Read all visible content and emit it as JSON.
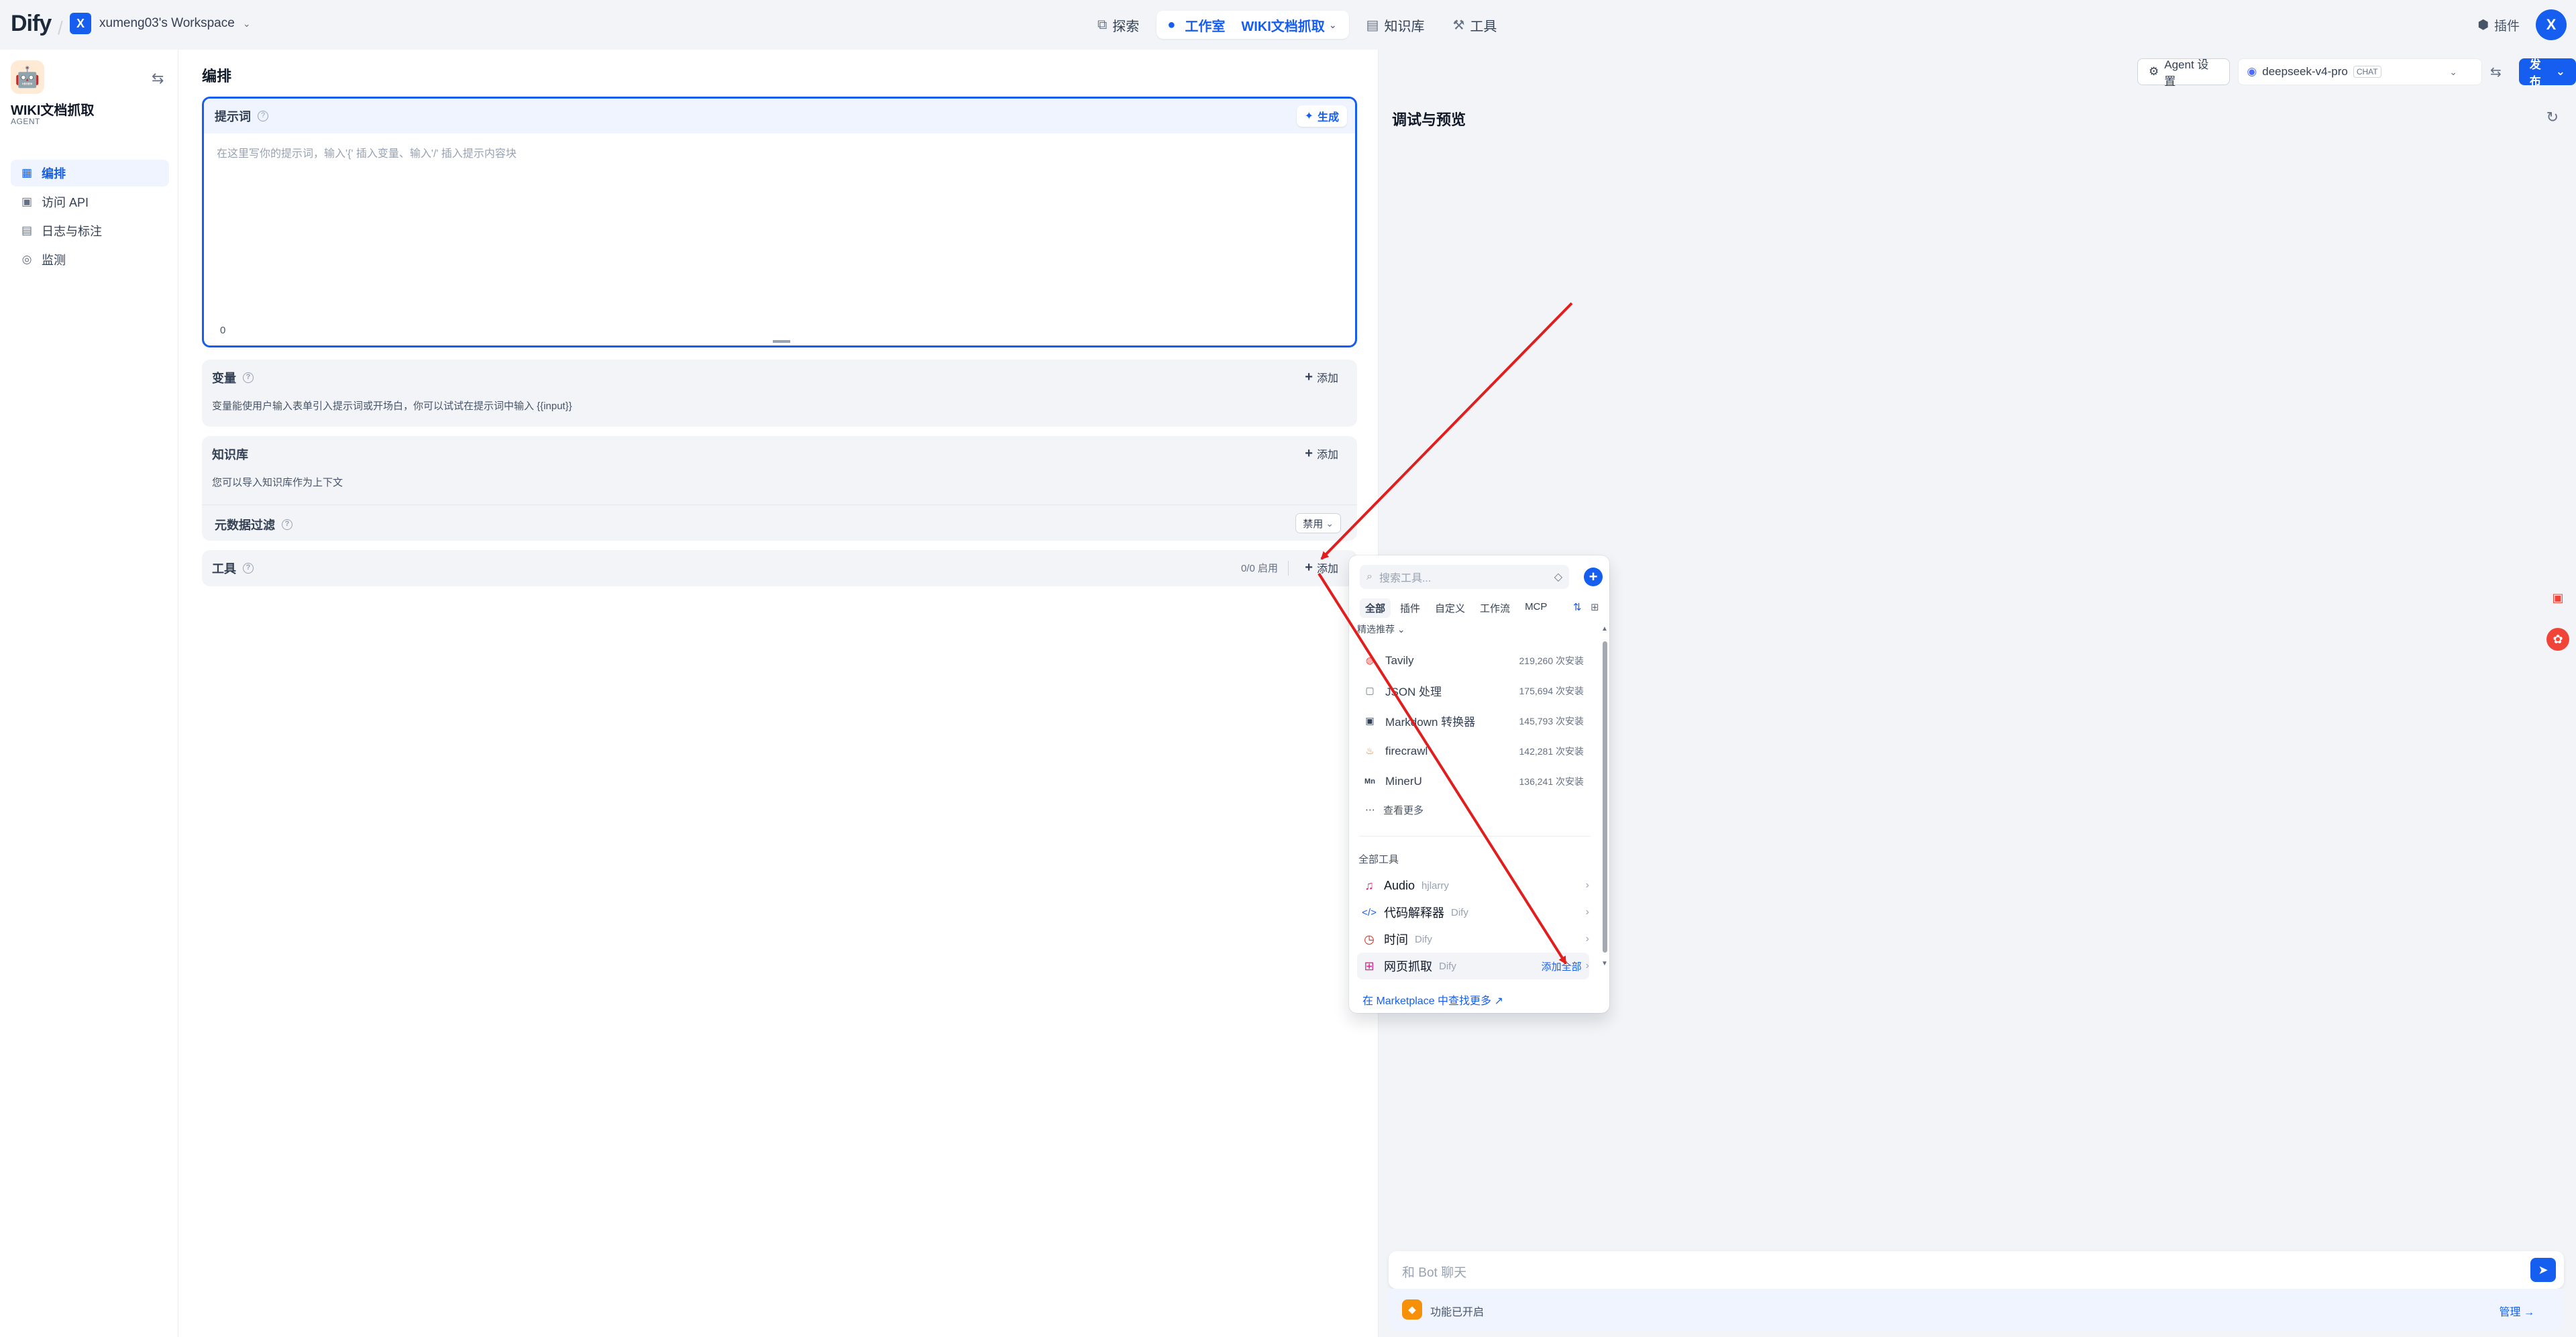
{
  "topnav": {
    "logo": "Dify",
    "workspace_badge": "X",
    "workspace_name": "xumeng03's Workspace",
    "explore": "探索",
    "studio": "工作室",
    "current_app": "WIKI文档抓取",
    "knowledge": "知识库",
    "tools": "工具",
    "plugins": "插件",
    "avatar": "X"
  },
  "sidebar": {
    "app_name": "WIKI文档抓取",
    "app_type": "AGENT",
    "items": [
      {
        "label": "编排",
        "icon": "layout-icon"
      },
      {
        "label": "访问 API",
        "icon": "terminal-icon"
      },
      {
        "label": "日志与标注",
        "icon": "file-list-icon"
      },
      {
        "label": "监测",
        "icon": "monitor-icon"
      }
    ]
  },
  "editor": {
    "title": "编排",
    "prompt_label": "提示词",
    "generate": "生成",
    "prompt_placeholder": "在这里写你的提示词，输入'{' 插入变量、输入'/' 插入提示内容块",
    "prompt_count": "0",
    "variables": {
      "title": "变量",
      "add": "添加",
      "desc": "变量能使用户输入表单引入提示词或开场白，你可以试试在提示词中输入 {{input}}"
    },
    "knowledge": {
      "title": "知识库",
      "add": "添加",
      "desc": "您可以导入知识库作为上下文",
      "meta_title": "元数据过滤",
      "meta_value": "禁用"
    },
    "tools": {
      "title": "工具",
      "count": "0/0 启用",
      "add": "添加"
    }
  },
  "header_right": {
    "agent_settings": "Agent 设置",
    "model": "deepseek-v4-pro",
    "model_tag": "CHAT",
    "publish": "发布"
  },
  "debug": {
    "title": "调试与预览",
    "chat_placeholder": "和 Bot 聊天",
    "features_enabled": "功能已开启",
    "manage": "管理"
  },
  "picker": {
    "search_placeholder": "搜索工具...",
    "tabs": [
      "全部",
      "插件",
      "自定义",
      "工作流",
      "MCP"
    ],
    "featured_label": "精选推荐",
    "featured": [
      {
        "name": "Tavily",
        "count": "219,260 次安装",
        "color": "#ef4444"
      },
      {
        "name": "JSON 处理",
        "count": "175,694 次安装",
        "color": "#667085"
      },
      {
        "name": "Markdown 转换器",
        "count": "145,793 次安装",
        "color": "#344054"
      },
      {
        "name": "firecrawl",
        "count": "142,281 次安装",
        "color": "#f97316"
      },
      {
        "name": "MinerU",
        "count": "136,241 次安装",
        "color": "#344054"
      }
    ],
    "view_more": "查看更多",
    "all_tools_label": "全部工具",
    "all_tools": [
      {
        "name": "Audio",
        "org": "hjlarry",
        "color": "#dd2590"
      },
      {
        "name": "代码解释器",
        "org": "Dify",
        "color": "#155eef"
      },
      {
        "name": "时间",
        "org": "Dify",
        "color": "#d92d20"
      },
      {
        "name": "网页抓取",
        "org": "Dify",
        "color": "#dd2590",
        "action": "添加全部"
      }
    ],
    "marketplace": "在 Marketplace 中查找更多 ↗"
  },
  "colors": {
    "accent": "#155eef",
    "annotation_arrow": "#e11d1d"
  }
}
